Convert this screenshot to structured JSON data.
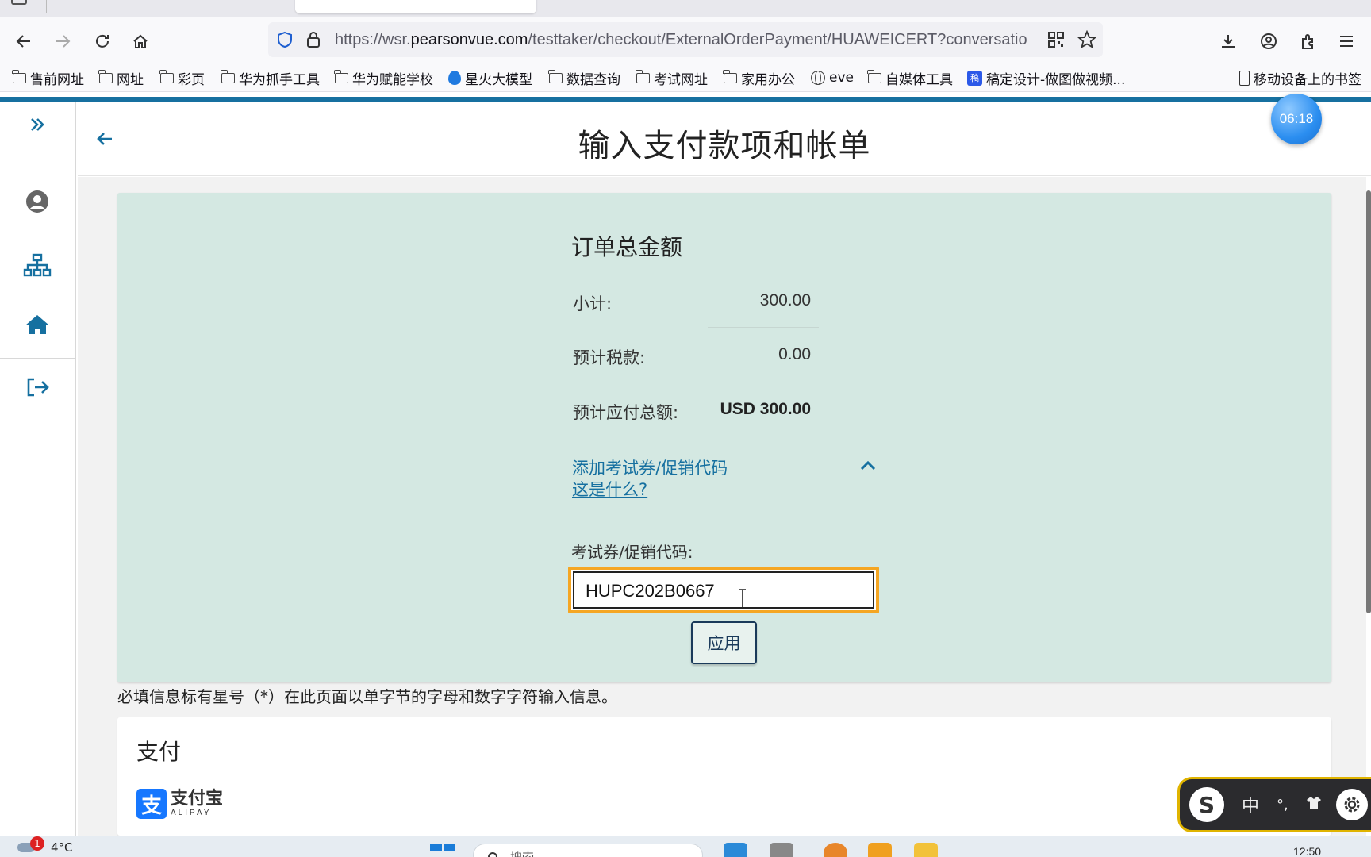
{
  "browser": {
    "url_prefix": "https://wsr.",
    "url_domain": "pearsonvue.com",
    "url_path": "/testtaker/checkout/ExternalOrderPayment/HUAWEICERT?conversatio",
    "bookmarks": [
      {
        "icon": "folder-icon",
        "label": "售前网址"
      },
      {
        "icon": "folder-icon",
        "label": "网址"
      },
      {
        "icon": "folder-icon",
        "label": "彩页"
      },
      {
        "icon": "folder-icon",
        "label": "华为抓手工具"
      },
      {
        "icon": "folder-icon",
        "label": "华为赋能学校"
      },
      {
        "icon": "flame-icon",
        "label": "星火大模型"
      },
      {
        "icon": "folder-icon",
        "label": "数据查询"
      },
      {
        "icon": "folder-icon",
        "label": "考试网址"
      },
      {
        "icon": "folder-icon",
        "label": "家用办公"
      },
      {
        "icon": "globe-icon",
        "label": "eve"
      },
      {
        "icon": "folder-icon",
        "label": "自媒体工具"
      },
      {
        "icon": "app-icon",
        "label": "稿定设计-做图做视频..."
      }
    ],
    "mobile_bookmarks": "移动设备上的书签",
    "app_badge_char": "稿"
  },
  "timer": "06:18",
  "page": {
    "title": "输入支付款项和帐单"
  },
  "order_summary": {
    "title": "订单总金额",
    "subtotal_label": "小计:",
    "subtotal_value": "300.00",
    "tax_label": "预计税款:",
    "tax_value": "0.00",
    "total_label": "预计应付总额:",
    "total_value": "USD 300.00"
  },
  "promo": {
    "toggle_label": "添加考试券/促销代码",
    "what_link": "这是什么?",
    "field_label": "考试券/促销代码:",
    "field_value": "HUPC202B0667",
    "apply_label": "应用"
  },
  "required_note": "必填信息标有星号（*）在此页面以单字节的字母和数字字符输入信息。",
  "payment": {
    "title": "支付",
    "alipay_cn": "支付宝",
    "alipay_en": "ALIPAY",
    "alipay_logo_char": "支"
  },
  "ime": {
    "logo": "S",
    "mode": "中",
    "punct": "°,",
    "skin_icon": "shirt-icon"
  },
  "taskbar": {
    "weather_badge": "1",
    "temperature": "4°C",
    "search_placeholder": "搜索",
    "clock": "12:50"
  },
  "colors": {
    "accent": "#1670a0",
    "panel_bg": "#d4e8e2",
    "focus_ring": "#f5a623"
  }
}
